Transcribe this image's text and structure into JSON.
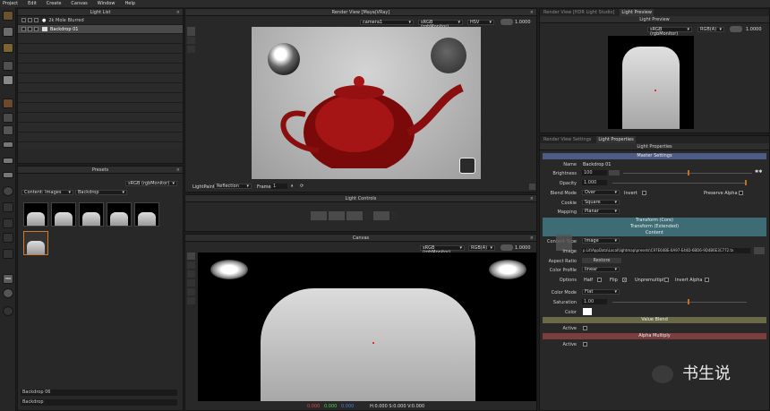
{
  "menu": [
    "Project",
    "Edit",
    "Create",
    "Canvas",
    "Window",
    "Help"
  ],
  "light_list": {
    "title": "Light List",
    "items": [
      "2k Mole Blurred",
      "Backdrop 01"
    ]
  },
  "presets": {
    "title": "Presets",
    "colorspace": "sRGB (rgbMonitor)",
    "content_label": "Content: Images",
    "category": "Backdrop",
    "footer": [
      "Backdrop 06",
      "Backdrop"
    ]
  },
  "render_view": {
    "title": "Render View [Maya|VRay]",
    "camera": "camera1",
    "colorspace": "sRGB (rgbMonitor)",
    "mode": "HSV",
    "exposure": "1.0000",
    "lightpaint_label": "LightPaint",
    "lightpaint_value": "Reflection",
    "frame_label": "Frame",
    "frame_value": "1"
  },
  "light_controls": {
    "title": "Light Controls"
  },
  "canvas": {
    "title": "Canvas",
    "colorspace": "sRGB (rgbMonitor)",
    "channel": "RGB(A)",
    "exposure": "1.0000",
    "status": "H:0.000 S:0.000 V:0.000"
  },
  "light_preview": {
    "tabs": [
      "Render View [HDR Light Studio]",
      "Light Preview"
    ],
    "title": "Light Preview",
    "colorspace": "sRGB (rgbMonitor)",
    "channel": "RGB(A)",
    "exposure": "1.0000"
  },
  "properties": {
    "tabs": [
      "Render View Settings",
      "Light Properties"
    ],
    "title": "Light Properties",
    "master": "Master Settings",
    "name_label": "Name",
    "name_value": "Backdrop 01",
    "brightness_label": "Brightness",
    "brightness_value": "100",
    "opacity_label": "Opacity",
    "opacity_value": "1.000",
    "blend_label": "Blend Mode",
    "blend_value": "Over",
    "invert_label": "Invert",
    "preserve_label": "Preserve Alpha",
    "cookie_label": "Cookie",
    "cookie_value": "Square",
    "mapping_label": "Mapping",
    "mapping_value": "Planar",
    "transform_core": "Transform (Core)",
    "transform_ext": "Transform (Extended)",
    "content": "Content",
    "content_type_label": "Content Type",
    "content_type_value": "Image",
    "image_label": "Image",
    "image_path": "p Lit\\AppData\\Local\\lightmap\\presets\\C97E64BE-0A97-E44D-6BD6-9D4B6E3C772.tx",
    "aspect_label": "Aspect Ratio",
    "restore_label": "Restore",
    "profile_label": "Color Profile",
    "profile_value": "linear",
    "options_label": "Options",
    "half_label": "Half",
    "flip_label": "Flip",
    "unpre_label": "Unpremultiply",
    "invalpha_label": "Invert Alpha",
    "colormode_label": "Color Mode",
    "colormode_value": "Flat",
    "saturation_label": "Saturation",
    "saturation_value": "1.00",
    "color_label": "Color",
    "value_blend": "Value Blend",
    "active_label": "Active",
    "alpha_multiply": "Alpha Multiply",
    "active2_label": "Active"
  },
  "watermark": "书生说",
  "colors": {
    "accent_orange": "#c07020",
    "section_blue": "#4e5b85",
    "section_teal": "#3e6c74",
    "section_olive": "#6a6a48",
    "section_red": "#7a3e3e"
  }
}
